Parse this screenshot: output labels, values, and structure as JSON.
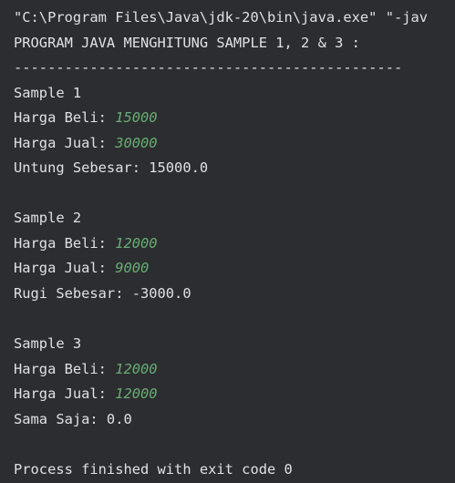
{
  "console": {
    "command_line": "\"C:\\Program Files\\Java\\jdk-20\\bin\\java.exe\" \"-jav",
    "header": "PROGRAM JAVA MENGHITUNG SAMPLE 1, 2 & 3 :",
    "divider": "----------------------------------------------",
    "samples": [
      {
        "title": "Sample 1",
        "buy_label": "Harga Beli: ",
        "buy_value": "15000",
        "sell_label": "Harga Jual: ",
        "sell_value": "30000",
        "result": "Untung Sebesar: 15000.0"
      },
      {
        "title": "Sample 2",
        "buy_label": "Harga Beli: ",
        "buy_value": "12000",
        "sell_label": "Harga Jual: ",
        "sell_value": "9000",
        "result": "Rugi Sebesar: -3000.0"
      },
      {
        "title": "Sample 3",
        "buy_label": "Harga Beli: ",
        "buy_value": "12000",
        "sell_label": "Harga Jual: ",
        "sell_value": "12000",
        "result": "Sama Saja: 0.0"
      }
    ],
    "exit_message": "Process finished with exit code 0"
  },
  "colors": {
    "background": "#2b2d30",
    "text": "#dfe1e5",
    "input": "#6aab73"
  }
}
